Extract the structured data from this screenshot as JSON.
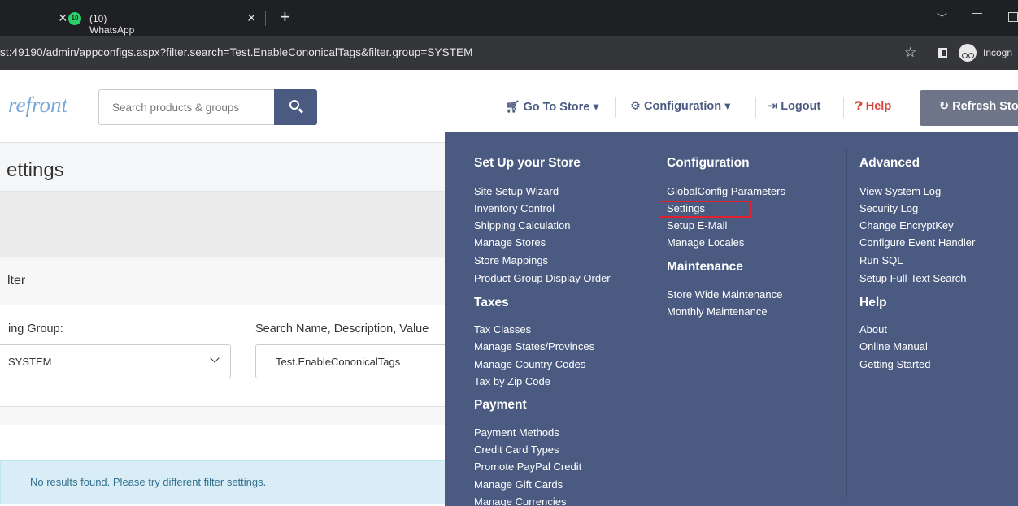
{
  "browser": {
    "tab_badge": "10",
    "tab_title": "(10) WhatsApp",
    "url": "st:49190/admin/appconfigs.aspx?filter.search=Test.EnableCononicalTags&filter.group=SYSTEM",
    "incognito_label": "Incogn"
  },
  "header": {
    "logo": "refront",
    "search_placeholder": "Search products & groups",
    "nav": {
      "go_to_store": "Go To Store",
      "configuration": "Configuration",
      "logout": "Logout",
      "help": "Help",
      "refresh": "Refresh Sto"
    }
  },
  "page": {
    "title": "ettings",
    "filter_title": "lter",
    "group_label": "ing Group:",
    "group_value": "SYSTEM",
    "search_label": "Search Name, Description, Value",
    "search_value": "Test.EnableCononicalTags",
    "alert": "No results found. Please try different filter settings."
  },
  "menu": {
    "col1": {
      "heading": "Set Up your Store",
      "items": [
        "Site Setup Wizard",
        "Inventory Control",
        "Shipping Calculation",
        "Manage Stores",
        "Store Mappings",
        "Product Group Display Order"
      ],
      "taxes_heading": "Taxes",
      "taxes_items": [
        "Tax Classes",
        "Manage States/Provinces",
        "Manage Country Codes",
        "Tax by Zip Code"
      ],
      "payment_heading": "Payment",
      "payment_items": [
        "Payment Methods",
        "Credit Card Types",
        "Promote PayPal Credit",
        "Manage Gift Cards",
        "Manage Currencies"
      ]
    },
    "col2": {
      "heading": "Configuration",
      "items": [
        "GlobalConfig Parameters",
        "Settings",
        "Setup E-Mail",
        "Manage Locales"
      ],
      "maintenance_heading": "Maintenance",
      "maintenance_items": [
        "Store Wide Maintenance",
        "Monthly Maintenance"
      ]
    },
    "col3": {
      "heading": "Advanced",
      "items": [
        "View System Log",
        "Security Log",
        "Change EncryptKey",
        "Configure Event Handler",
        "Run SQL",
        "Setup Full-Text Search"
      ],
      "help_heading": "Help",
      "help_items": [
        "About",
        "Online Manual",
        "Getting Started"
      ]
    }
  },
  "colors": {
    "menu_bg": "#4a5a80",
    "highlight": "#e3202d",
    "help": "#d9463a",
    "alert_bg": "#d9edf7"
  }
}
